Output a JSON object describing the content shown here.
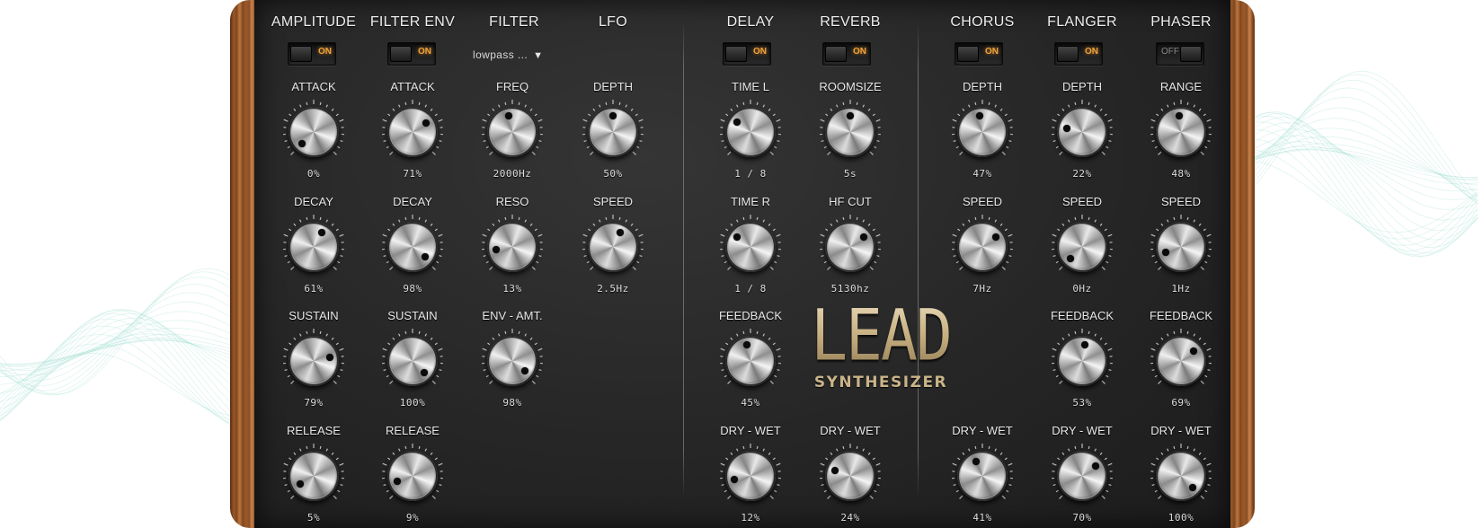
{
  "colors": {
    "panel": "#262626",
    "accent_on": "#f0a23a",
    "logo": "#d9c7a2",
    "waves": "#8fd9c9"
  },
  "logo": {
    "word": "LEAD",
    "sub": "SYNTHESIZER"
  },
  "sections": [
    {
      "id": "amplitude",
      "title": "AMPLITUDE",
      "toggle": "ON"
    },
    {
      "id": "filter-env",
      "title": "FILTER ENV",
      "toggle": "ON"
    },
    {
      "id": "filter",
      "title": "FILTER",
      "dropdown": "lowpass ..."
    },
    {
      "id": "lfo",
      "title": "LFO"
    },
    {
      "id": "delay",
      "title": "DELAY",
      "toggle": "ON"
    },
    {
      "id": "reverb",
      "title": "REVERB",
      "toggle": "ON"
    },
    {
      "id": "chorus",
      "title": "CHORUS",
      "toggle": "ON"
    },
    {
      "id": "flanger",
      "title": "FLANGER",
      "toggle": "ON"
    },
    {
      "id": "phaser",
      "title": "PHASER",
      "toggle": "OFF"
    }
  ],
  "knobs": [
    {
      "id": "amp-attack",
      "label": "ATTACK",
      "value": "0%",
      "level": 0.0
    },
    {
      "id": "amp-decay",
      "label": "DECAY",
      "value": "61%",
      "level": 0.61
    },
    {
      "id": "amp-sustain",
      "label": "SUSTAIN",
      "value": "79%",
      "level": 0.79
    },
    {
      "id": "amp-release",
      "label": "RELEASE",
      "value": "5%",
      "level": 0.05
    },
    {
      "id": "fenv-attack",
      "label": "ATTACK",
      "value": "71%",
      "level": 0.71
    },
    {
      "id": "fenv-decay",
      "label": "DECAY",
      "value": "98%",
      "level": 0.98
    },
    {
      "id": "fenv-sustain",
      "label": "SUSTAIN",
      "value": "100%",
      "level": 1.0
    },
    {
      "id": "fenv-release",
      "label": "RELEASE",
      "value": "9%",
      "level": 0.09
    },
    {
      "id": "filter-freq",
      "label": "FREQ",
      "value": "2000Hz",
      "level": 0.45
    },
    {
      "id": "filter-reso",
      "label": "RESO",
      "value": "13%",
      "level": 0.13
    },
    {
      "id": "filter-env-amt",
      "label": "ENV - AMT.",
      "value": "98%",
      "level": 0.98
    },
    {
      "id": "lfo-depth",
      "label": "DEPTH",
      "value": "50%",
      "level": 0.5
    },
    {
      "id": "lfo-speed",
      "label": "SPEED",
      "value": "2.5Hz",
      "level": 0.6
    },
    {
      "id": "delay-time-l",
      "label": "TIME L",
      "value": "1 / 8",
      "level": 0.3
    },
    {
      "id": "delay-time-r",
      "label": "TIME R",
      "value": "1 / 8",
      "level": 0.3
    },
    {
      "id": "delay-feedback",
      "label": "FEEDBACK",
      "value": "45%",
      "level": 0.45
    },
    {
      "id": "delay-drywet",
      "label": "DRY - WET",
      "value": "12%",
      "level": 0.12
    },
    {
      "id": "reverb-roomsize",
      "label": "ROOMSIZE",
      "value": "5s",
      "level": 0.5
    },
    {
      "id": "reverb-hfcut",
      "label": "HF CUT",
      "value": "5130hz",
      "level": 0.7
    },
    {
      "id": "reverb-drywet",
      "label": "DRY - WET",
      "value": "24%",
      "level": 0.24
    },
    {
      "id": "chorus-depth",
      "label": "DEPTH",
      "value": "47%",
      "level": 0.47
    },
    {
      "id": "chorus-speed",
      "label": "SPEED",
      "value": "7Hz",
      "level": 0.7
    },
    {
      "id": "chorus-drywet",
      "label": "DRY - WET",
      "value": "41%",
      "level": 0.41
    },
    {
      "id": "flanger-depth",
      "label": "DEPTH",
      "value": "22%",
      "level": 0.22
    },
    {
      "id": "flanger-speed",
      "label": "SPEED",
      "value": "0Hz",
      "level": 0.0
    },
    {
      "id": "flanger-feedback",
      "label": "FEEDBACK",
      "value": "53%",
      "level": 0.53
    },
    {
      "id": "flanger-drywet",
      "label": "DRY - WET",
      "value": "70%",
      "level": 0.7
    },
    {
      "id": "phaser-range",
      "label": "RANGE",
      "value": "48%",
      "level": 0.48
    },
    {
      "id": "phaser-speed",
      "label": "SPEED",
      "value": "1Hz",
      "level": 0.1
    },
    {
      "id": "phaser-feedback",
      "label": "FEEDBACK",
      "value": "69%",
      "level": 0.69
    },
    {
      "id": "phaser-drywet",
      "label": "DRY - WET",
      "value": "100%",
      "level": 1.0
    }
  ]
}
